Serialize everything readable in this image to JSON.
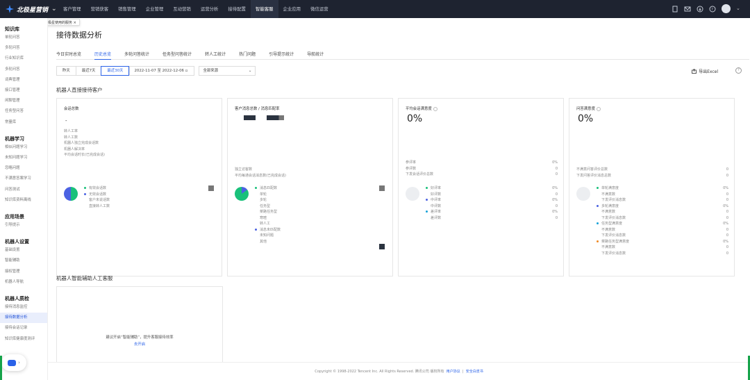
{
  "brand": {
    "name": "北极星营销"
  },
  "nav": [
    "客户管理",
    "营销获客",
    "销售管理",
    "企业管理",
    "互动营销",
    "运营分析",
    "接待配置",
    "智能客服",
    "企业应用",
    "微信运营"
  ],
  "tooltip": "点击立即切换极星使用的服务",
  "sidebar": [
    {
      "heading": "知识库",
      "items": [
        "单轮问答",
        "多轮问答",
        "行业知识库",
        "多轮问答",
        "词典管理",
        "接口管理",
        "闲聊管理",
        "任务型问答",
        "常量库"
      ]
    },
    {
      "heading": "机器学习",
      "items": [
        "相似问题学习",
        "未知问题学习",
        "忽略问题",
        "不满意答案学习",
        "问答测试",
        "知识库资料离线"
      ]
    },
    {
      "heading": "应用场景",
      "items": [
        "引导提示"
      ]
    },
    {
      "heading": "机器人设置",
      "items": [
        "基础设置",
        "智能辅助",
        "接权管理",
        "机器人导航"
      ]
    },
    {
      "heading": "机器人质检",
      "items": [
        "接待消息监控",
        "接待数据分析",
        "接待会话记录",
        "知识库健康度测评"
      ]
    }
  ],
  "page": {
    "title": "接待数据分析",
    "export": "导出Excel",
    "help": "?"
  },
  "tabs": [
    "今日实时总览",
    "历史总览",
    "多轮问答统计",
    "任务型问答统计",
    "转人工统计",
    "热门问题",
    "引导提示统计",
    "导航统计"
  ],
  "filters": {
    "buttons": [
      "昨天",
      "最近7天",
      "最近30天"
    ],
    "date_range": "2022-11-07 至 2022-12-06",
    "source": "全部来源"
  },
  "section1": "机器人直接接待客户",
  "card1": {
    "title": "会话总数",
    "value": "-",
    "lines": [
      "转人工率",
      "转人工数",
      "机器人独立完成会话数",
      "机器人解决率",
      "平均会话时长(已完成会话)"
    ],
    "legend": [
      "有效会话数",
      "无效会话数",
      "客户未说话数",
      "直接转人工数"
    ]
  },
  "card2": {
    "title": "客户消息总数 / 消息匹配率",
    "lines": [
      "独立访客数",
      "平均每通会话消息数(已完成会话)"
    ],
    "legend": [
      "消息匹配数",
      "单轮",
      "多轮",
      "任务型",
      "菜路任务型",
      "寒暄",
      "转人工",
      "消息未匹配数",
      "未知问题",
      "其他"
    ]
  },
  "card3": {
    "title": "平均会话满意度",
    "value": "0%",
    "rows": [
      [
        "参评率",
        "0%"
      ],
      [
        "参评数",
        "0"
      ],
      [
        "下发会话评价总数",
        "0"
      ]
    ],
    "legend": [
      [
        "好评率",
        "0%"
      ],
      [
        "好评数",
        "0"
      ],
      [
        "中评率",
        "0%"
      ],
      [
        "中评数",
        "0"
      ],
      [
        "差评率",
        "0%"
      ],
      [
        "差评数",
        "0"
      ]
    ]
  },
  "card4": {
    "title": "问答满意度",
    "value": "0%",
    "rows": [
      [
        "不满意问答评价总数",
        "0"
      ],
      [
        "下发问答评价消息总数",
        "0"
      ]
    ],
    "legend": [
      [
        "单轮满意度",
        "0%"
      ],
      [
        "不满意数",
        "0"
      ],
      [
        "下发评价消息数",
        "0"
      ],
      [
        "多轮满意度",
        "0%"
      ],
      [
        "不满意数",
        "0"
      ],
      [
        "下发评价消息数",
        "0"
      ],
      [
        "任务型满意度",
        "0%"
      ],
      [
        "不满意数",
        "0"
      ],
      [
        "下发评价消息数",
        "0"
      ],
      [
        "菜路任务型满意度",
        "0%"
      ],
      [
        "不满意数",
        "0"
      ],
      [
        "下发评价消息数",
        "0"
      ]
    ]
  },
  "section2": "机器人智能辅助人工客服",
  "assist": {
    "text": "建议开启“智能辅助”，提升客服接待效率",
    "link": "去开启"
  },
  "footer": {
    "copyright": "Copyright © 1998-2022 Tencent Inc. All Rights Reserved. 腾讯公司 版权所有",
    "link1": "用户协议",
    "sep": "|",
    "link2": "安全白皮书"
  },
  "colors": {
    "accent": "#2a62e8",
    "green": "#19c17a",
    "blue": "#4b62e2",
    "orange": "#f08a24"
  }
}
